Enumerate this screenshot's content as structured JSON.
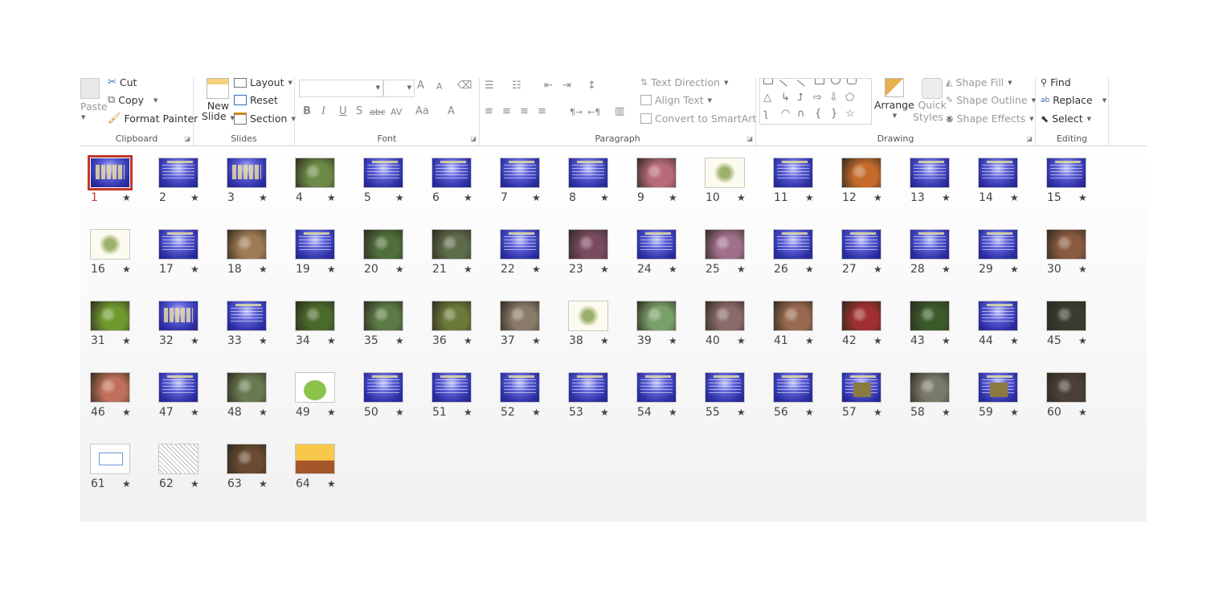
{
  "ribbon": {
    "clipboard": {
      "label": "Clipboard",
      "paste": "Paste",
      "cut": "Cut",
      "copy": "Copy",
      "format_painter": "Format Painter"
    },
    "slides": {
      "label": "Slides",
      "new_slide_line1": "New",
      "new_slide_line2": "Slide",
      "layout": "Layout",
      "reset": "Reset",
      "section": "Section"
    },
    "font": {
      "label": "Font",
      "buttons": [
        "B",
        "I",
        "U",
        "S",
        "abc",
        "AV",
        "Aa",
        "A"
      ],
      "grow": "A",
      "shrink": "A"
    },
    "paragraph": {
      "label": "Paragraph",
      "text_direction": "Text Direction",
      "align_text": "Align Text",
      "convert_smartart": "Convert to SmartArt"
    },
    "drawing": {
      "label": "Drawing",
      "arrange": "Arrange",
      "quick_styles_line1": "Quick",
      "quick_styles_line2": "Styles",
      "shape_fill": "Shape Fill",
      "shape_outline": "Shape Outline",
      "shape_effects": "Shape Effects"
    },
    "editing": {
      "label": "Editing",
      "find": "Find",
      "replace": "Replace",
      "select": "Select"
    }
  },
  "sorter": {
    "selected_slide": "1",
    "star_glyph": "★",
    "slides": [
      {
        "n": "1",
        "kind": "bigtitle"
      },
      {
        "n": "2",
        "kind": "text"
      },
      {
        "n": "3",
        "kind": "bigtitle"
      },
      {
        "n": "4",
        "kind": "photo",
        "color": "#6b8a45"
      },
      {
        "n": "5",
        "kind": "text"
      },
      {
        "n": "6",
        "kind": "text"
      },
      {
        "n": "7",
        "kind": "text"
      },
      {
        "n": "8",
        "kind": "text"
      },
      {
        "n": "9",
        "kind": "photo",
        "color": "#b66a7a"
      },
      {
        "n": "10",
        "kind": "illustration"
      },
      {
        "n": "11",
        "kind": "text"
      },
      {
        "n": "12",
        "kind": "photo",
        "color": "#c56a2a"
      },
      {
        "n": "13",
        "kind": "text"
      },
      {
        "n": "14",
        "kind": "text"
      },
      {
        "n": "15",
        "kind": "text"
      },
      {
        "n": "16",
        "kind": "illustration"
      },
      {
        "n": "17",
        "kind": "text"
      },
      {
        "n": "18",
        "kind": "photo",
        "color": "#9e7a55"
      },
      {
        "n": "19",
        "kind": "text"
      },
      {
        "n": "20",
        "kind": "photo",
        "color": "#4f6e3a"
      },
      {
        "n": "21",
        "kind": "photo",
        "color": "#5d6b4a"
      },
      {
        "n": "22",
        "kind": "text"
      },
      {
        "n": "23",
        "kind": "photo",
        "color": "#7a4a60"
      },
      {
        "n": "24",
        "kind": "text"
      },
      {
        "n": "25",
        "kind": "photo",
        "color": "#a0708a"
      },
      {
        "n": "26",
        "kind": "text"
      },
      {
        "n": "27",
        "kind": "text"
      },
      {
        "n": "28",
        "kind": "text"
      },
      {
        "n": "29",
        "kind": "text"
      },
      {
        "n": "30",
        "kind": "photo",
        "color": "#8a5a40"
      },
      {
        "n": "31",
        "kind": "photo",
        "color": "#6f9a2f"
      },
      {
        "n": "32",
        "kind": "bigtitle"
      },
      {
        "n": "33",
        "kind": "text"
      },
      {
        "n": "34",
        "kind": "photo",
        "color": "#4a6a2a"
      },
      {
        "n": "35",
        "kind": "photo",
        "color": "#5b7a45"
      },
      {
        "n": "36",
        "kind": "photo",
        "color": "#6a7a3a"
      },
      {
        "n": "37",
        "kind": "photo",
        "color": "#8a7a6a"
      },
      {
        "n": "38",
        "kind": "illustration"
      },
      {
        "n": "39",
        "kind": "photo",
        "color": "#7aa06a"
      },
      {
        "n": "40",
        "kind": "photo",
        "color": "#8a6a6a"
      },
      {
        "n": "41",
        "kind": "photo",
        "color": "#9a6a50"
      },
      {
        "n": "42",
        "kind": "photo",
        "color": "#a03030"
      },
      {
        "n": "43",
        "kind": "photo",
        "color": "#3a5a2a"
      },
      {
        "n": "44",
        "kind": "text"
      },
      {
        "n": "45",
        "kind": "photo",
        "color": "#3a3a30"
      },
      {
        "n": "46",
        "kind": "photo",
        "color": "#c0705a"
      },
      {
        "n": "47",
        "kind": "text"
      },
      {
        "n": "48",
        "kind": "photo",
        "color": "#6a7a50"
      },
      {
        "n": "49",
        "kind": "map"
      },
      {
        "n": "50",
        "kind": "text"
      },
      {
        "n": "51",
        "kind": "text"
      },
      {
        "n": "52",
        "kind": "text"
      },
      {
        "n": "53",
        "kind": "text"
      },
      {
        "n": "54",
        "kind": "text"
      },
      {
        "n": "55",
        "kind": "text"
      },
      {
        "n": "56",
        "kind": "text"
      },
      {
        "n": "57",
        "kind": "textphoto"
      },
      {
        "n": "58",
        "kind": "photo",
        "color": "#7a7a6a"
      },
      {
        "n": "59",
        "kind": "textphoto"
      },
      {
        "n": "60",
        "kind": "photo",
        "color": "#4a4038"
      },
      {
        "n": "61",
        "kind": "diagram"
      },
      {
        "n": "62",
        "kind": "sketch"
      },
      {
        "n": "63",
        "kind": "photo",
        "color": "#6a4a30"
      },
      {
        "n": "64",
        "kind": "illustration2"
      }
    ]
  },
  "colors": {
    "selection": "#c0392b",
    "slide_blue": "#2d2fa3"
  }
}
